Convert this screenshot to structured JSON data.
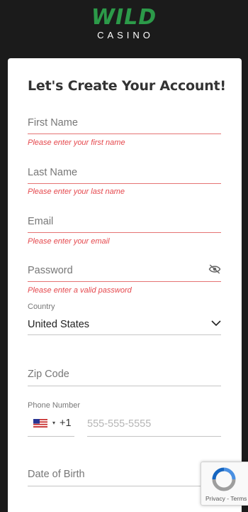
{
  "brand": {
    "name_top": "WILD",
    "name_bottom": "CASINO"
  },
  "form": {
    "title": "Let's Create Your Account!",
    "first_name": {
      "placeholder": "First Name",
      "error": "Please enter your first name"
    },
    "last_name": {
      "placeholder": "Last Name",
      "error": "Please enter your last name"
    },
    "email": {
      "placeholder": "Email",
      "error": "Please enter your email"
    },
    "password": {
      "placeholder": "Password",
      "error": "Please enter a valid password",
      "toggle_icon": "eye-slash-icon"
    },
    "country": {
      "label": "Country",
      "selected": "United States",
      "icon": "chevron-down-icon"
    },
    "zip": {
      "placeholder": "Zip Code"
    },
    "phone": {
      "label": "Phone Number",
      "country_code": "+1",
      "placeholder": "555-555-5555",
      "flag": "us-flag-icon"
    },
    "dob": {
      "placeholder": "Date of Birth"
    }
  },
  "recaptcha": {
    "terms": "Privacy - Terms"
  },
  "colors": {
    "brand_green": "#2c9a49",
    "error_red": "#e5484d",
    "background": "#1b1b1b"
  }
}
